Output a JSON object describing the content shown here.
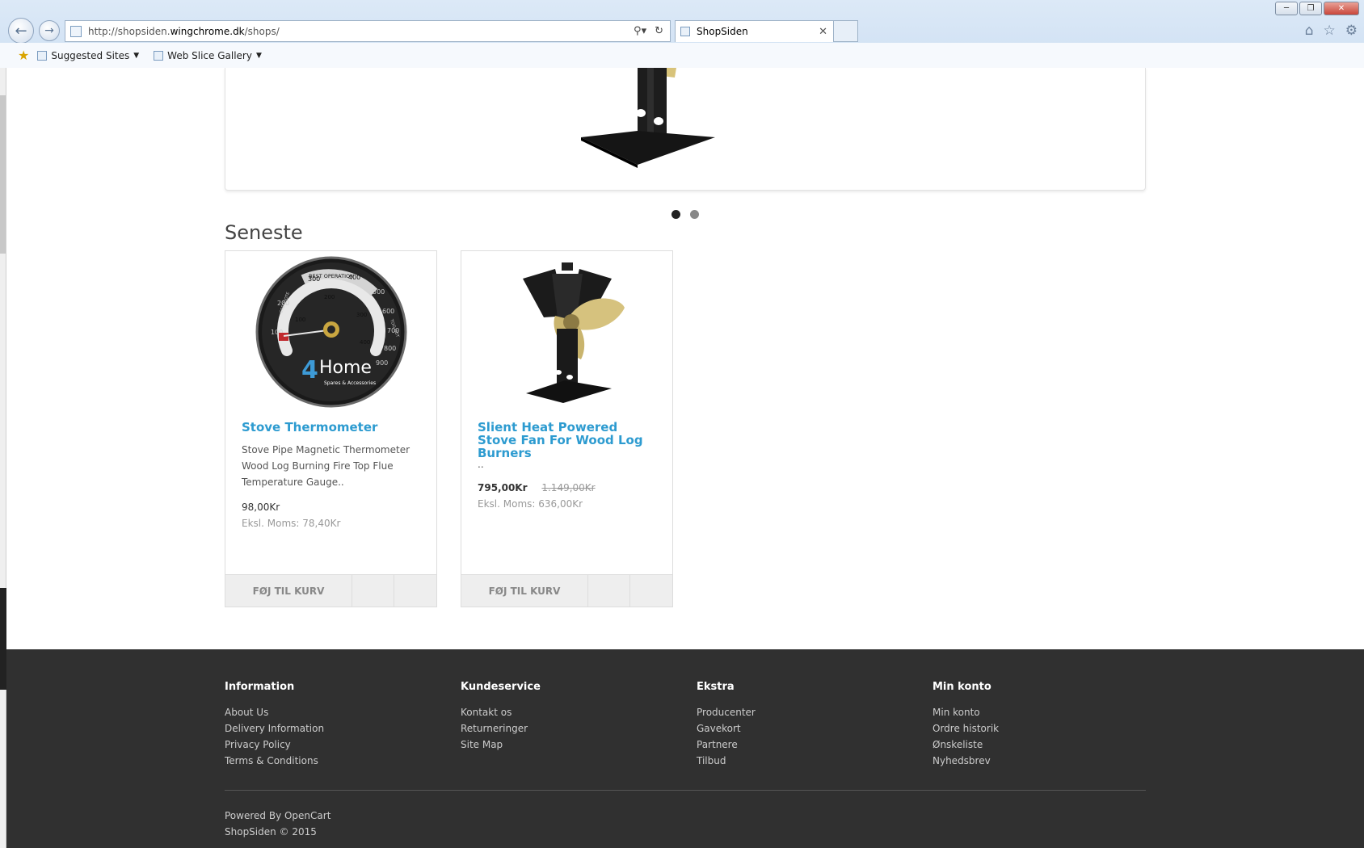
{
  "browser": {
    "url_prefix": "http://shopsiden.",
    "url_domain": "wingchrome.dk",
    "url_path": "/shops/",
    "tab_title": "ShopSiden",
    "favorites": [
      {
        "label": "Suggested Sites"
      },
      {
        "label": "Web Slice Gallery"
      }
    ]
  },
  "carousel": {
    "slide_count": 2,
    "active_index": 0
  },
  "section": {
    "title": "Seneste"
  },
  "products": [
    {
      "name": "Stove Thermometer",
      "description": " Stove Pipe Magnetic Thermometer Wood Log Burning Fire Top Flue Temperature Gauge..",
      "price": "98,00Kr",
      "old_price": "",
      "tax": "Eksl. Moms: 78,40Kr",
      "cart_label": "FØJ TIL KURV"
    },
    {
      "name": "Slient Heat Powered Stove Fan For Wood Log Burners",
      "description": "..",
      "price": "795,00Kr",
      "old_price": "1.149,00Kr",
      "tax": "Eksl. Moms: 636,00Kr",
      "cart_label": "FØJ TIL KURV"
    }
  ],
  "thermometer_dial": {
    "outer_labels": [
      "BEST OPERATION",
      "CREOSOTE",
      "TOO HOT"
    ],
    "numbers": [
      "300",
      "400",
      "500",
      "200",
      "100",
      "600",
      "700",
      "800",
      "900"
    ],
    "inner_numbers": [
      "100",
      "200",
      "300",
      "400"
    ],
    "brand_num": "4",
    "brand": "Home",
    "tagline": "Spares & Accessories"
  },
  "footer": {
    "columns": [
      {
        "title": "Information",
        "links": [
          "About Us",
          "Delivery Information",
          "Privacy Policy",
          "Terms & Conditions"
        ]
      },
      {
        "title": "Kundeservice",
        "links": [
          "Kontakt os",
          "Returneringer",
          "Site Map"
        ]
      },
      {
        "title": "Ekstra",
        "links": [
          "Producenter",
          "Gavekort",
          "Partnere",
          "Tilbud"
        ]
      },
      {
        "title": "Min konto",
        "links": [
          "Min konto",
          "Ordre historik",
          "Ønskeliste",
          "Nyhedsbrev"
        ]
      }
    ],
    "powered_prefix": "Powered By ",
    "powered_link": "OpenCart",
    "copyright": "ShopSiden © 2015"
  }
}
